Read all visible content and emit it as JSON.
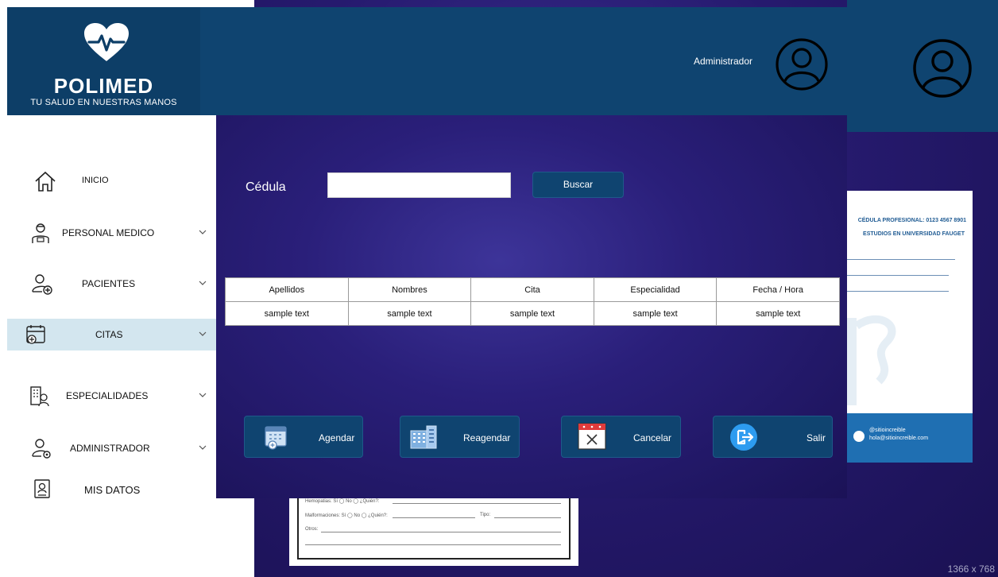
{
  "app": {
    "brand_name": "POLIMED",
    "tagline": "TU SALUD EN NUESTRAS MANOS",
    "user_name": "Administrador"
  },
  "sidebar": {
    "items": [
      {
        "label": "INICIO",
        "icon": "home-icon",
        "has_chevron": false,
        "active": false
      },
      {
        "label": "PERSONAL MEDICO",
        "icon": "doctor-icon",
        "has_chevron": true,
        "active": false
      },
      {
        "label": "PACIENTES",
        "icon": "add-user-icon",
        "has_chevron": true,
        "active": false
      },
      {
        "label": "CITAS",
        "icon": "calendar-icon",
        "has_chevron": true,
        "active": true
      },
      {
        "label": "ESPECIALIDADES",
        "icon": "hospital-building-icon",
        "has_chevron": true,
        "active": false
      },
      {
        "label": "ADMINISTRADOR",
        "icon": "admin-user-icon",
        "has_chevron": true,
        "active": false
      },
      {
        "label": "MIS DATOS",
        "icon": "id-card-icon",
        "has_chevron": false,
        "active": false
      }
    ]
  },
  "search": {
    "label": "Cédula",
    "value": "",
    "placeholder": "",
    "button_label": "Buscar"
  },
  "table": {
    "columns": [
      "Apellidos",
      "Nombres",
      "Cita",
      "Especialidad",
      "Fecha / Hora"
    ],
    "rows": [
      [
        "sample text",
        "sample text",
        "sample text",
        "sample text",
        "sample text"
      ]
    ]
  },
  "actions": {
    "agendar": "Agendar",
    "reagendar": "Reagendar",
    "cancelar": "Cancelar",
    "salir": "Salir"
  },
  "background": {
    "card_line1": "CÉDULA PROFESIONAL: 0123 4567 8901",
    "card_line2": "ESTUDIOS EN UNIVERSIDAD FAUGET",
    "card_footer1": "@sitioincreible",
    "card_footer2": "hola@sitioincreible.com",
    "form_row1": "Hemopatias: Sí ◯ No ◯ ¿Quién?:",
    "form_row2": "Malformaciones: Sí ◯ No ◯ ¿Quién?:",
    "form_row2_tipo": "Tipo:",
    "form_row3": "Otros:",
    "size_label": "1366 x 768"
  },
  "colors": {
    "header": "#0f4470",
    "content_bg": "#2a1f7a",
    "active_nav": "#d3e6ef",
    "button": "#0f4470"
  }
}
